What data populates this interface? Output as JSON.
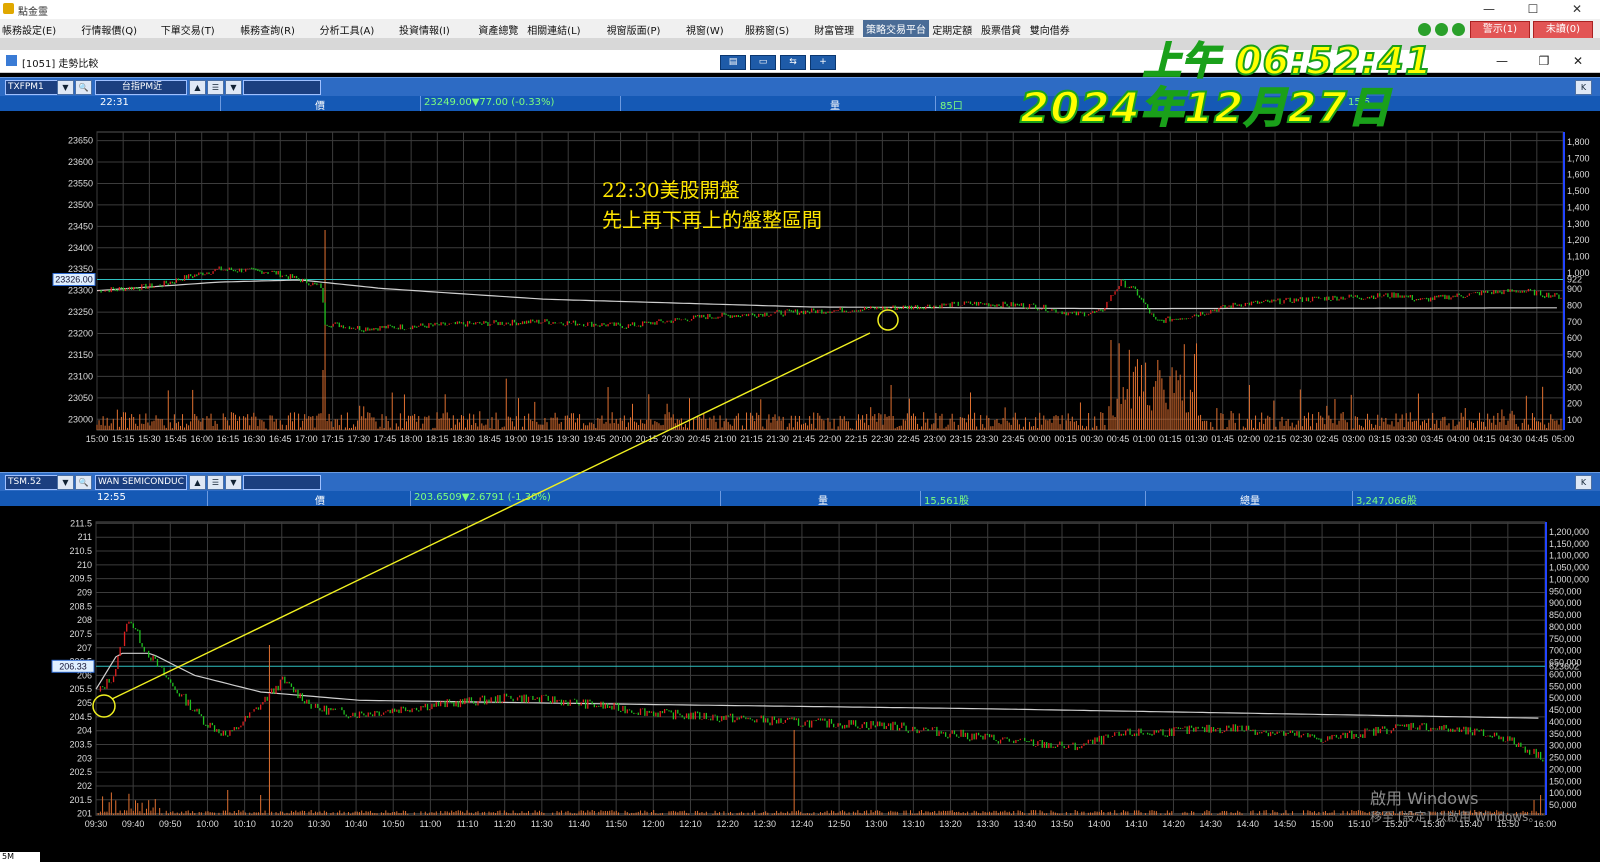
{
  "app_title": "點金靈",
  "menu": [
    "帳務設定(E)",
    "行情報價(Q)",
    "下單交易(T)",
    "帳務查詢(R)",
    "分析工具(A)",
    "投資情報(I)",
    "資產總覽",
    "相關連結(L)",
    "視窗版面(P)",
    "視窗(W)",
    "服務窗(S)",
    "財富管理",
    "策略交易平台",
    "定期定額",
    "股票借貸",
    "雙向借券"
  ],
  "menu_active": "策略交易平台",
  "alert_buttons": {
    "warn": "警示(1)",
    "unread": "未讀(0)"
  },
  "window": {
    "title": "[1051] 走勢比較"
  },
  "clock": {
    "time": "上午 06:52:41",
    "date": "2024年12月27日"
  },
  "callout": {
    "line1": "22:30美股開盤",
    "line2": "先上再下再上的盤整區間"
  },
  "watermark": {
    "line1": "啟用 Windows",
    "line2": "移至 [設定] 以啟用 Windows。"
  },
  "top_pane": {
    "symbol": "TXFPM1",
    "name": "台指PM近",
    "info": {
      "time": "22:31",
      "price_label": "價",
      "price": "23249.00▼77.00 (-0.33%)",
      "vol_label": "量",
      "vol": "85口",
      "total": "15,5"
    },
    "k_button": "K",
    "ref_label": "23326.00",
    "ref_vol_label": "922",
    "y_ticks": [
      "23650",
      "23600",
      "23550",
      "23500",
      "23450",
      "23400",
      "23350",
      "23300",
      "23250",
      "23200",
      "23150",
      "23100",
      "23050",
      "23000"
    ],
    "vol_ticks": [
      "1,800",
      "1,700",
      "1,600",
      "1,500",
      "1,400",
      "1,300",
      "1,200",
      "1,100",
      "1,000",
      "900",
      "800",
      "700",
      "600",
      "500",
      "400",
      "300",
      "200",
      "100"
    ],
    "x_ticks": [
      "15:00",
      "15:15",
      "15:30",
      "15:45",
      "16:00",
      "16:15",
      "16:30",
      "16:45",
      "17:00",
      "17:15",
      "17:30",
      "17:45",
      "18:00",
      "18:15",
      "18:30",
      "18:45",
      "19:00",
      "19:15",
      "19:30",
      "19:45",
      "20:00",
      "20:15",
      "20:30",
      "20:45",
      "21:00",
      "21:15",
      "21:30",
      "21:45",
      "22:00",
      "22:15",
      "22:30",
      "22:45",
      "23:00",
      "23:15",
      "23:30",
      "23:45",
      "00:00",
      "00:15",
      "00:30",
      "00:45",
      "01:00",
      "01:15",
      "01:30",
      "01:45",
      "02:00",
      "02:15",
      "02:30",
      "02:45",
      "03:00",
      "03:15",
      "03:30",
      "03:45",
      "04:00",
      "04:15",
      "04:30",
      "04:45",
      "05:00"
    ],
    "colors": {
      "grid": "#3c3c3c",
      "up": "#e02020",
      "down": "#20c020",
      "ref": "#2fc0c0",
      "vol": "#e07030",
      "avg": "#cfcfcf",
      "axis": "#2244ff"
    }
  },
  "bottom_pane": {
    "symbol": "TSM.52",
    "name": "WAN SEMICONDUC",
    "info": {
      "time": "12:55",
      "price_label": "價",
      "price": "203.6509▼2.6791 (-1.30%)",
      "vol_label": "量",
      "vol": "15,561股",
      "total_label": "總量",
      "total": "3,247,066股"
    },
    "k_button": "K",
    "ref_label": "206.33",
    "ref_vol_label": "623602",
    "y_ticks": [
      "211.5",
      "211",
      "210.5",
      "210",
      "209.5",
      "209",
      "208.5",
      "208",
      "207.5",
      "207",
      "206.5",
      "206",
      "205.5",
      "205",
      "204.5",
      "204",
      "203.5",
      "203",
      "202.5",
      "202",
      "201.5",
      "201"
    ],
    "vol_ticks": [
      "1,200,000",
      "1,150,000",
      "1,100,000",
      "1,050,000",
      "1,000,000",
      "950,000",
      "900,000",
      "850,000",
      "800,000",
      "750,000",
      "700,000",
      "650,000",
      "600,000",
      "550,000",
      "500,000",
      "450,000",
      "400,000",
      "350,000",
      "300,000",
      "250,000",
      "200,000",
      "150,000",
      "100,000",
      "50,000"
    ],
    "x_ticks": [
      "09:30",
      "09:40",
      "09:50",
      "10:00",
      "10:10",
      "10:20",
      "10:30",
      "10:40",
      "10:50",
      "11:00",
      "11:10",
      "11:20",
      "11:30",
      "11:40",
      "11:50",
      "12:00",
      "12:10",
      "12:20",
      "12:30",
      "12:40",
      "12:50",
      "13:00",
      "13:10",
      "13:20",
      "13:30",
      "13:40",
      "13:50",
      "14:00",
      "14:10",
      "14:20",
      "14:30",
      "14:40",
      "14:50",
      "15:00",
      "15:10",
      "15:20",
      "15:30",
      "15:40",
      "15:50",
      "16:00"
    ]
  },
  "bottom_corner": "5M"
}
